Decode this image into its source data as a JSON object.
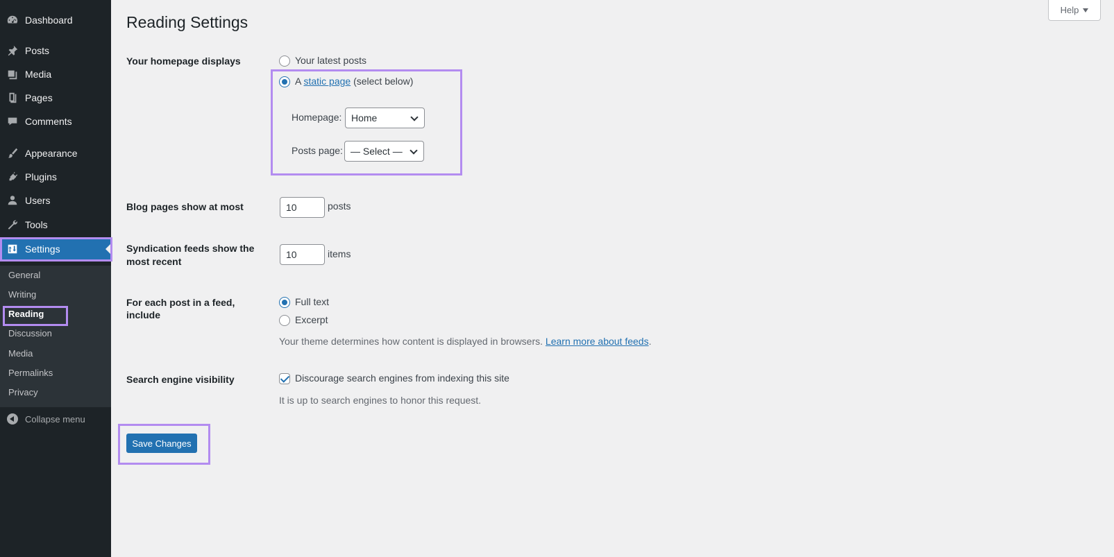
{
  "sidebar": {
    "items": [
      {
        "label": "Dashboard",
        "icon": "dashboard-icon"
      },
      {
        "label": "Posts",
        "icon": "pin-icon"
      },
      {
        "label": "Media",
        "icon": "media-icon"
      },
      {
        "label": "Pages",
        "icon": "pages-icon"
      },
      {
        "label": "Comments",
        "icon": "comment-icon"
      },
      {
        "label": "Appearance",
        "icon": "brush-icon"
      },
      {
        "label": "Plugins",
        "icon": "plug-icon"
      },
      {
        "label": "Users",
        "icon": "user-icon"
      },
      {
        "label": "Tools",
        "icon": "wrench-icon"
      },
      {
        "label": "Settings",
        "icon": "settings-icon"
      }
    ],
    "submenu": [
      "General",
      "Writing",
      "Reading",
      "Discussion",
      "Media",
      "Permalinks",
      "Privacy"
    ],
    "collapse_label": "Collapse menu"
  },
  "header": {
    "title": "Reading Settings",
    "help_label": "Help"
  },
  "form": {
    "homepage_displays": {
      "label": "Your homepage displays",
      "option_latest": "Your latest posts",
      "option_static_prefix": "A",
      "option_static_link": "static page",
      "option_static_suffix": "(select below)",
      "selected": "static",
      "homepage_label": "Homepage:",
      "homepage_value": "Home",
      "posts_page_label": "Posts page:",
      "posts_page_value": "— Select —"
    },
    "blog_pages": {
      "label": "Blog pages show at most",
      "value": "10",
      "unit": "posts"
    },
    "syndication": {
      "label_line1": "Syndication feeds show the",
      "label_line2": "most recent",
      "value": "10",
      "unit": "items"
    },
    "feed_content": {
      "label_line1": "For each post in a feed,",
      "label_line2": "include",
      "option_full": "Full text",
      "option_excerpt": "Excerpt",
      "selected": "full",
      "description": "Your theme determines how content is displayed in browsers.",
      "learn_more": "Learn more about feeds",
      "period": "."
    },
    "search_visibility": {
      "label": "Search engine visibility",
      "checkbox_label": "Discourage search engines from indexing this site",
      "checked": true,
      "description": "It is up to search engines to honor this request."
    },
    "save_label": "Save Changes"
  },
  "colors": {
    "sidebar_bg": "#1d2327",
    "accent": "#2271b1",
    "highlight": "#b38cf0",
    "page_bg": "#f0f0f1"
  }
}
